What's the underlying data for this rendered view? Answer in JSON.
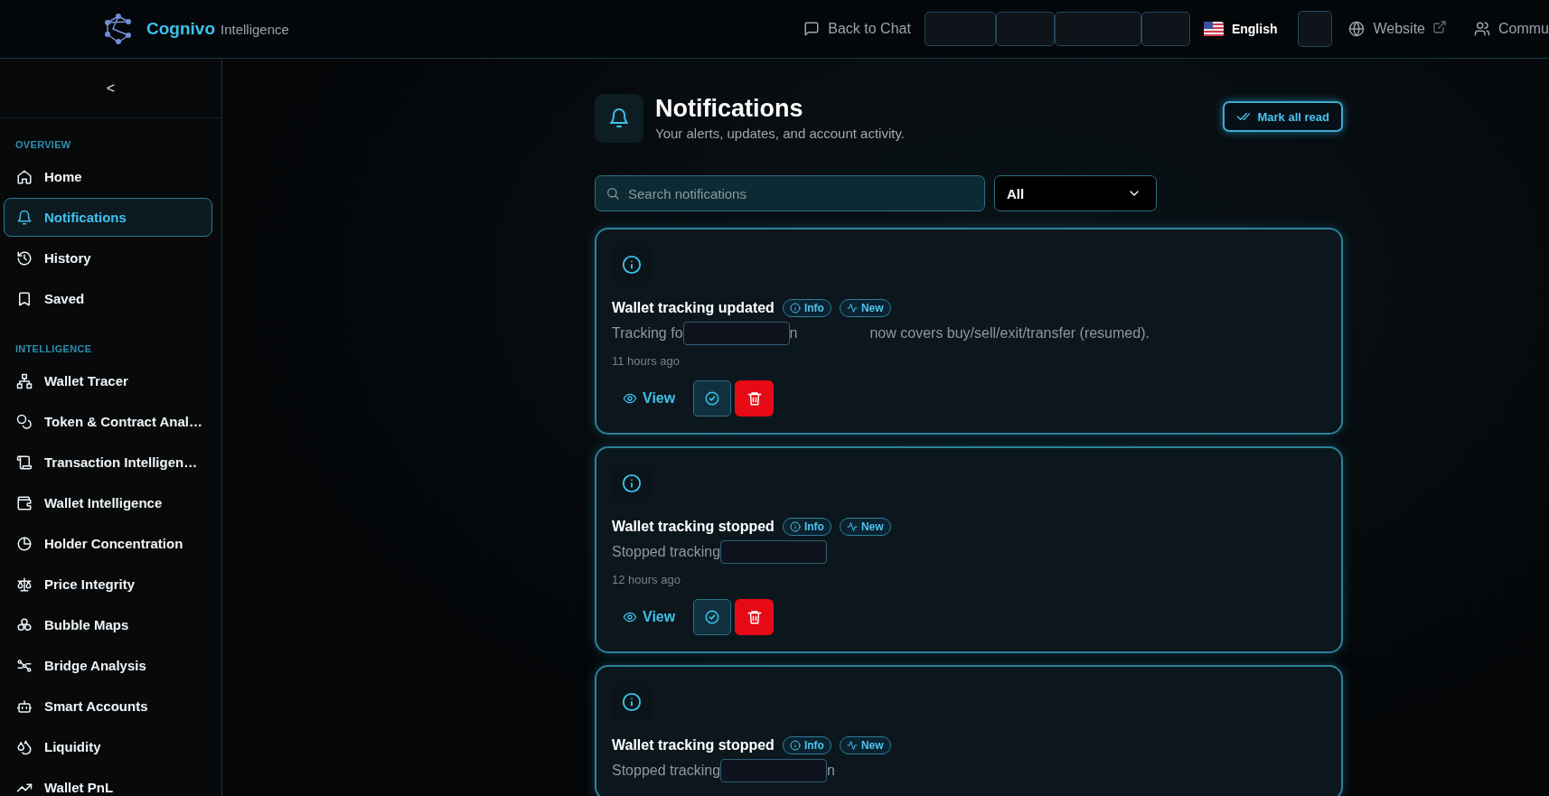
{
  "header": {
    "brand": "Cognivo",
    "brand_sub": "Intelligence",
    "back_link": "Back to Chat",
    "language": "English",
    "website_link": "Website",
    "community_link": "Commu"
  },
  "sidebar": {
    "collapse": "<",
    "sections": [
      {
        "title": "OVERVIEW",
        "items": [
          {
            "label": "Home",
            "selected": false
          },
          {
            "label": "Notifications",
            "selected": true
          },
          {
            "label": "History",
            "selected": false
          },
          {
            "label": "Saved",
            "selected": false
          }
        ]
      },
      {
        "title": "INTELLIGENCE",
        "items": [
          {
            "label": "Wallet Tracer",
            "selected": false
          },
          {
            "label": "Token & Contract Anal…",
            "selected": false
          },
          {
            "label": "Transaction Intelligen…",
            "selected": false
          },
          {
            "label": "Wallet Intelligence",
            "selected": false
          },
          {
            "label": "Holder Concentration",
            "selected": false
          },
          {
            "label": "Price Integrity",
            "selected": false
          },
          {
            "label": "Bubble Maps",
            "selected": false
          },
          {
            "label": "Bridge Analysis",
            "selected": false
          },
          {
            "label": "Smart Accounts",
            "selected": false
          },
          {
            "label": "Liquidity",
            "selected": false
          },
          {
            "label": "Wallet PnL",
            "selected": false
          }
        ]
      }
    ]
  },
  "page": {
    "title": "Notifications",
    "subtitle": "Your alerts, updates, and account activity.",
    "mark_all": "Mark all read",
    "search": {
      "placeholder": "Search notifications"
    },
    "filter": {
      "value": "All"
    }
  },
  "notifications": [
    {
      "title": "Wallet tracking updated",
      "badges": [
        "Info",
        "New"
      ],
      "body": [
        {
          "kind": "text",
          "text": "Tracking fo"
        },
        {
          "kind": "redacted"
        },
        {
          "kind": "text",
          "text": "n"
        },
        {
          "kind": "text",
          "text": "now covers buy/sell/exit/transfer (resumed)."
        }
      ],
      "time": "11 hours ago",
      "view": "View"
    },
    {
      "title": "Wallet tracking stopped",
      "badges": [
        "Info",
        "New"
      ],
      "body": [
        {
          "kind": "text",
          "text": "Stopped tracking"
        },
        {
          "kind": "redacted"
        }
      ],
      "time": "12 hours ago",
      "view": "View"
    },
    {
      "title": "Wallet tracking stopped",
      "badges": [
        "Info",
        "New"
      ],
      "body": [
        {
          "kind": "text",
          "text": "Stopped tracking"
        },
        {
          "kind": "redacted"
        },
        {
          "kind": "text",
          "text": "n"
        }
      ]
    }
  ]
}
